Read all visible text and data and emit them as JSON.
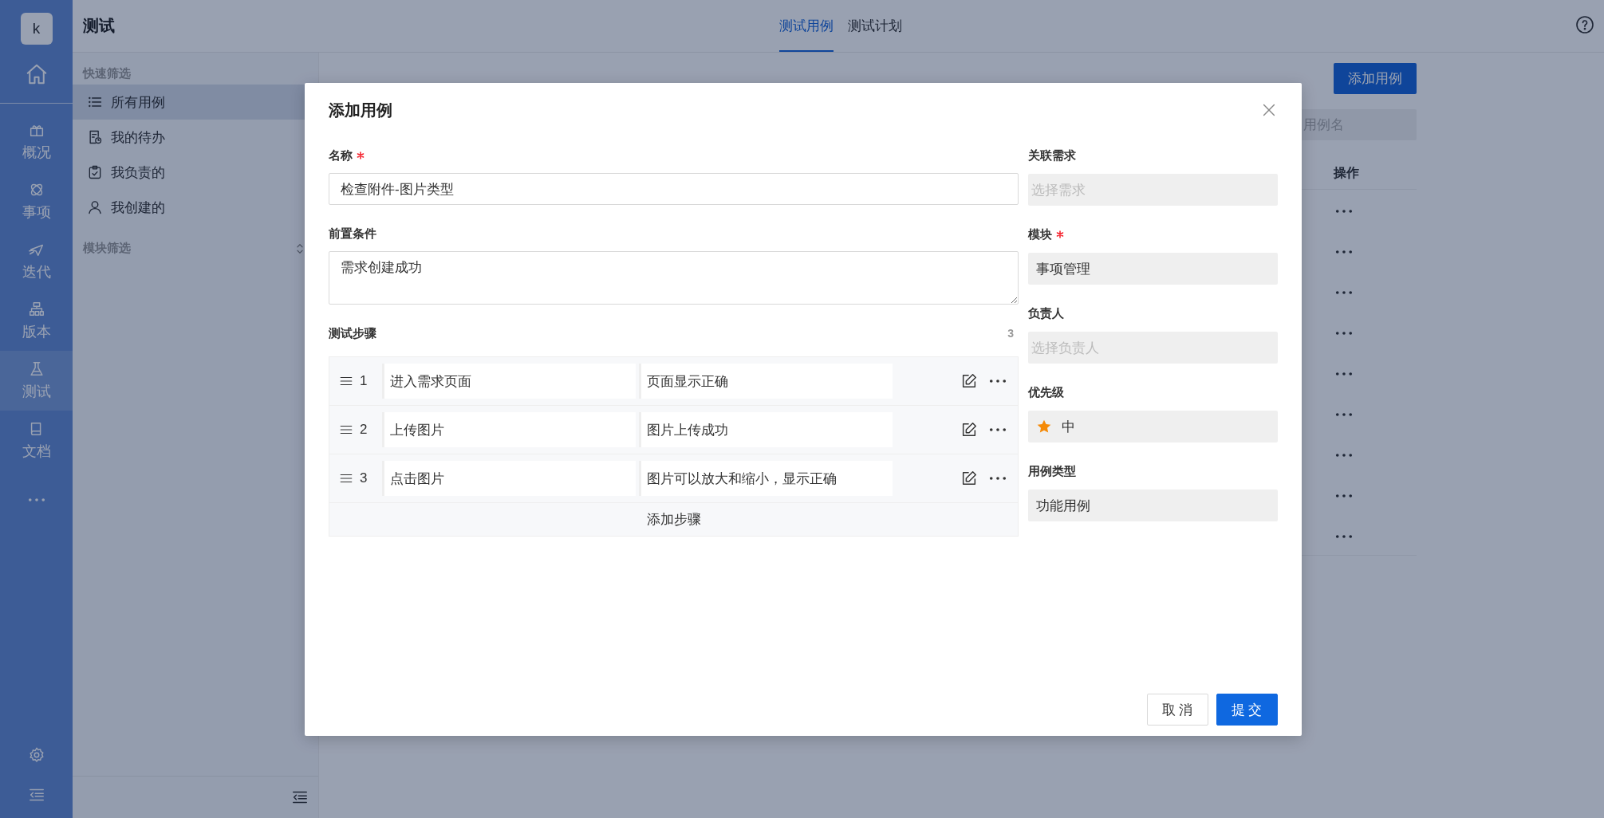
{
  "nav": {
    "avatar": "k",
    "items": [
      {
        "label": "概况",
        "selected": false
      },
      {
        "label": "事项",
        "selected": false
      },
      {
        "label": "迭代",
        "selected": false
      },
      {
        "label": "版本",
        "selected": false
      },
      {
        "label": "测试",
        "selected": true
      },
      {
        "label": "文档",
        "selected": false
      }
    ]
  },
  "header": {
    "title": "测试",
    "tabs": [
      {
        "label": "测试用例",
        "selected": true
      },
      {
        "label": "测试计划",
        "selected": false
      }
    ]
  },
  "sidebar": {
    "quick_filter_title": "快速筛选",
    "items": [
      {
        "label": "所有用例",
        "selected": true
      },
      {
        "label": "我的待办",
        "selected": false
      },
      {
        "label": "我负责的",
        "selected": false
      },
      {
        "label": "我创建的",
        "selected": false
      }
    ],
    "module_filter_title": "模块筛选"
  },
  "main": {
    "add_button": "添加用例",
    "search": {
      "placeholder": "用例名"
    },
    "table": {
      "columns": [
        "操作"
      ],
      "rows": [
        {
          "kind": "actions"
        },
        {
          "kind": "actions"
        },
        {
          "kind": "actions"
        },
        {
          "kind": "actions"
        },
        {
          "kind": "actions"
        },
        {
          "kind": "actions"
        },
        {
          "kind": "actions"
        },
        {
          "kind": "actions"
        },
        {
          "kind": "actions"
        }
      ]
    }
  },
  "dialog": {
    "title": "添加用例",
    "fields": [
      {
        "kind": "input",
        "label": "名称",
        "required": true,
        "value": "检查附件-图片类型"
      },
      {
        "kind": "textarea",
        "label": "前置条件",
        "required": false,
        "value": "需求创建成功"
      }
    ],
    "steps": {
      "title": "测试步骤",
      "count": "3",
      "rows": [
        {
          "index": "1",
          "action": "进入需求页面",
          "expected": "页面显示正确"
        },
        {
          "index": "2",
          "action": "上传图片",
          "expected": "图片上传成功"
        },
        {
          "index": "3",
          "action": "点击图片",
          "expected": "图片可以放大和缩小，显示正确"
        }
      ],
      "add_label": "添加步骤"
    },
    "side_fields": [
      {
        "kind": "select",
        "label": "关联需求",
        "required": false,
        "placeholder": "选择需求"
      },
      {
        "kind": "select",
        "label": "模块",
        "required": true,
        "value": "事项管理"
      },
      {
        "kind": "select",
        "label": "负责人",
        "required": false,
        "placeholder": "选择负责人"
      },
      {
        "kind": "priority",
        "label": "优先级",
        "required": false,
        "value": "中"
      },
      {
        "kind": "select",
        "label": "用例类型",
        "required": false,
        "value": "功能用例"
      }
    ],
    "buttons": [
      {
        "kind": "secondary",
        "label": "取消"
      },
      {
        "kind": "primary",
        "label": "提交"
      }
    ]
  }
}
